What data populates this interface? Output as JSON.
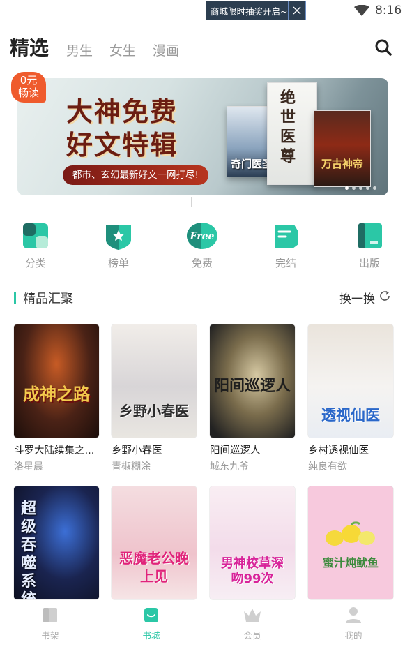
{
  "status_bar": {
    "toast_text": "商城限时抽奖开启~",
    "time": "8:16"
  },
  "header": {
    "tabs": [
      {
        "label": "精选",
        "active": true
      },
      {
        "label": "男生",
        "active": false
      },
      {
        "label": "女生",
        "active": false
      },
      {
        "label": "漫画",
        "active": false
      }
    ],
    "search_icon": "search-icon"
  },
  "banner": {
    "badge_line1": "0元",
    "badge_line2": "畅读",
    "title_line1": "大神免费",
    "title_line2": "好文特辑",
    "subtitle": "都市、玄幻最新好文一网打尽!",
    "covers": [
      {
        "text": "奇门医圣"
      },
      {
        "text": "绝世医尊"
      },
      {
        "text": "万古神帝"
      }
    ],
    "dots": 5
  },
  "categories": [
    {
      "label": "分类",
      "icon": "category-icon"
    },
    {
      "label": "榜单",
      "icon": "ranking-icon"
    },
    {
      "label": "免费",
      "icon": "free-icon",
      "badge": "Free"
    },
    {
      "label": "完结",
      "icon": "finished-icon"
    },
    {
      "label": "出版",
      "icon": "publish-icon"
    }
  ],
  "section": {
    "title": "精品汇聚",
    "refresh_label": "换一换"
  },
  "books": [
    {
      "title": "斗罗大陆续集之...",
      "author": "洛星晨",
      "cover_text": "成神之路"
    },
    {
      "title": "乡野小春医",
      "author": "青椒糊涂",
      "cover_text": "乡野小春医"
    },
    {
      "title": "阳间巡逻人",
      "author": "城东九爷",
      "cover_text": "阳间巡逻人"
    },
    {
      "title": "乡村透视仙医",
      "author": "纯良有欲",
      "cover_text": "透视仙医"
    },
    {
      "title": "",
      "author": "",
      "cover_text": "超级吞噬系统"
    },
    {
      "title": "",
      "author": "",
      "cover_text": "恶魔老公晚上见"
    },
    {
      "title": "",
      "author": "",
      "cover_text": "男神校草深吻99次"
    },
    {
      "title": "",
      "author": "",
      "cover_text": "蜜汁炖鱿鱼"
    }
  ],
  "bottom_nav": [
    {
      "label": "书架",
      "icon": "bookshelf-icon",
      "active": false
    },
    {
      "label": "书城",
      "icon": "bookstore-icon",
      "active": true
    },
    {
      "label": "会员",
      "icon": "vip-crown-icon",
      "active": false
    },
    {
      "label": "我的",
      "icon": "user-icon",
      "active": false
    }
  ],
  "colors": {
    "accent": "#2bc7a6",
    "inactive": "#aaaaaa"
  }
}
